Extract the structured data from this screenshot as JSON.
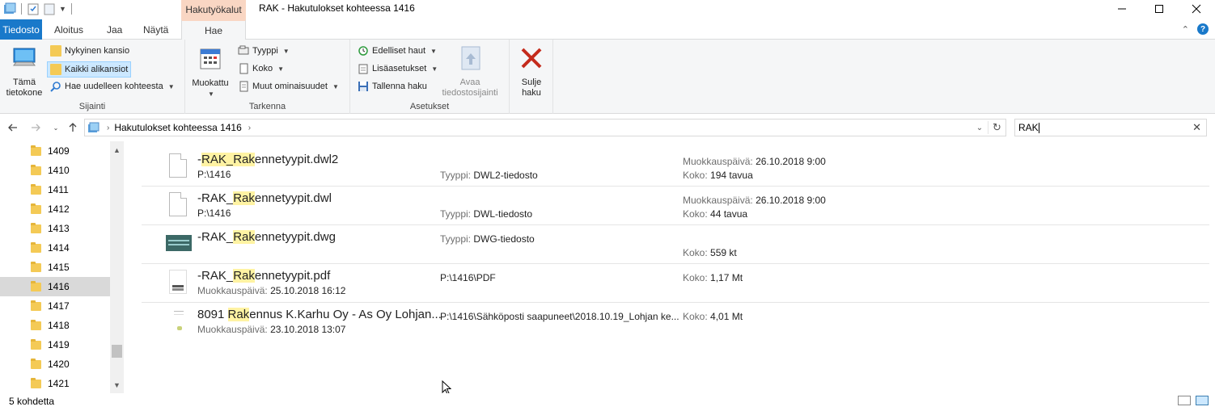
{
  "window": {
    "title": "RAK - Hakutulokset kohteessa 1416",
    "context_tab_header": "Hakutyökalut",
    "buttons": [
      "minimize",
      "maximize",
      "close"
    ]
  },
  "tabs": {
    "file": "Tiedosto",
    "home": "Aloitus",
    "share": "Jaa",
    "view": "Näytä",
    "search": "Hae"
  },
  "ribbon": {
    "location": {
      "label": "Sijainti",
      "this_pc_line1": "Tämä",
      "this_pc_line2": "tietokone",
      "current_folder": "Nykyinen kansio",
      "all_subfolders": "Kaikki alikansiot",
      "search_again": "Hae uudelleen kohteesta"
    },
    "refine": {
      "label": "Tarkenna",
      "modified": "Muokattu",
      "type": "Tyyppi",
      "size": "Koko",
      "other_props": "Muut ominaisuudet"
    },
    "options": {
      "label": "Asetukset",
      "recent": "Edelliset haut",
      "advanced": "Lisäasetukset",
      "save": "Tallenna haku",
      "open_loc_line1": "Avaa",
      "open_loc_line2": "tiedostosijainti"
    },
    "close_line1": "Sulje",
    "close_line2": "haku"
  },
  "address": {
    "crumb": "Hakutulokset kohteessa 1416",
    "search_value": "RAK"
  },
  "nav_tree": [
    {
      "label": "1409"
    },
    {
      "label": "1410"
    },
    {
      "label": "1411"
    },
    {
      "label": "1412"
    },
    {
      "label": "1413"
    },
    {
      "label": "1414"
    },
    {
      "label": "1415"
    },
    {
      "label": "1416",
      "selected": true
    },
    {
      "label": "1417"
    },
    {
      "label": "1418"
    },
    {
      "label": "1419"
    },
    {
      "label": "1420"
    },
    {
      "label": "1421"
    }
  ],
  "results": [
    {
      "name_pre": "-",
      "name_hl1": "RAK",
      "name_mid": "_",
      "name_hl2": "Rak",
      "name_post": "ennetyypit.dwl2",
      "sub": "P:\\1416",
      "type_key": "Tyyppi:",
      "type_val": "DWL2-tiedosto",
      "mod_key": "Muokkauspäivä:",
      "mod_val": "26.10.2018 9:00",
      "size_key": "Koko:",
      "size_val": "194 tavua"
    },
    {
      "name_pre": "-RAK_",
      "name_hl2": "Rak",
      "name_post": "ennetyypit.dwl",
      "sub": "P:\\1416",
      "type_key": "Tyyppi:",
      "type_val": "DWL-tiedosto",
      "mod_key": "Muokkauspäivä:",
      "mod_val": "26.10.2018 9:00",
      "size_key": "Koko:",
      "size_val": "44 tavua"
    },
    {
      "name_pre": "-RAK_",
      "name_hl2": "Rak",
      "name_post": "ennetyypit.dwg",
      "type_key": "Tyyppi:",
      "type_val": "DWG-tiedosto",
      "size_key": "Koko:",
      "size_val": "559 kt"
    },
    {
      "name_pre": "-RAK_",
      "name_hl2": "Rak",
      "name_post": "ennetyypit.pdf",
      "sub_key": "Muokkauspäivä:",
      "sub_val": "25.10.2018 16:12",
      "path": "P:\\1416\\PDF",
      "size_key": "Koko:",
      "size_val": "1,17 Mt"
    },
    {
      "name_pre": "8091 ",
      "name_hl2": "Rak",
      "name_post": "ennus K.Karhu Oy - As Oy Lohjan...",
      "sub_key": "Muokkauspäivä:",
      "sub_val": "23.10.2018 13:07",
      "path": "P:\\1416\\Sähköposti saapuneet\\2018.10.19_Lohjan ke...",
      "size_key": "Koko:",
      "size_val": "4,01 Mt"
    }
  ],
  "status": {
    "count": "5 kohdetta"
  },
  "colors": {
    "file_tab": "#1979ca",
    "context_header": "#f9d6c3",
    "highlight": "#fff3a3",
    "selected_button": "#cce8ff",
    "close_x": "#c42b1c"
  }
}
